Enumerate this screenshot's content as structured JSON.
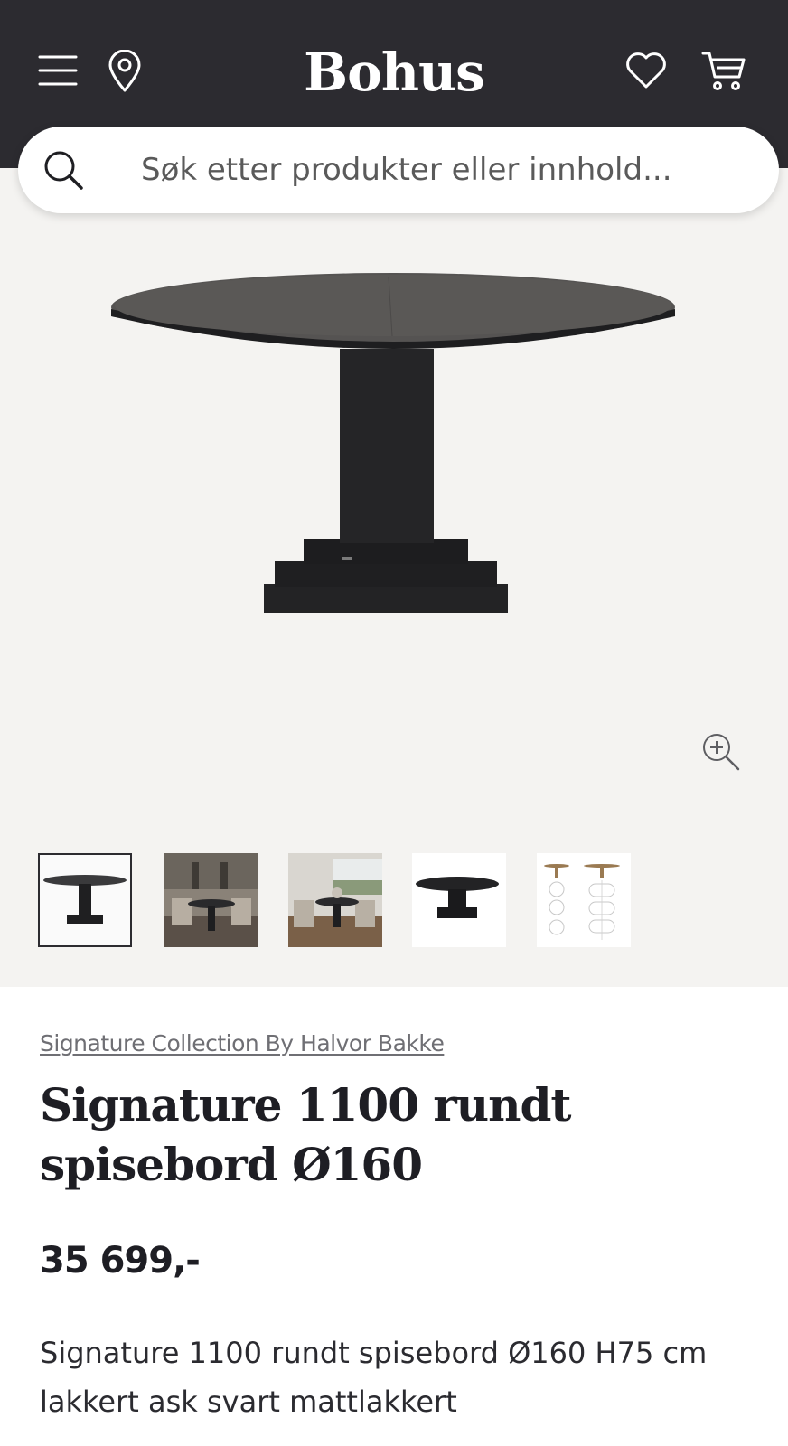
{
  "header": {
    "logo": "Bohus",
    "icons": [
      "menu-icon",
      "location-icon",
      "heart-icon",
      "cart-icon"
    ]
  },
  "search": {
    "placeholder": "Søk etter produkter eller innhold...",
    "value": ""
  },
  "gallery": {
    "thumbnail_count": 5,
    "active_thumbnail": 1,
    "zoom_icon": "zoom-in-icon"
  },
  "product": {
    "brand": "Signature Collection By Halvor Bakke",
    "title": "Signature 1100 rundt spisebord Ø160",
    "price": "35 699,-",
    "description": "Signature 1100 rundt spisebord Ø160 H75 cm lakkert ask svart mattlakkert"
  },
  "colors": {
    "header_bg": "#2c2b30",
    "gallery_bg": "#f4f3f1",
    "table_dark": "#2a2a2c"
  }
}
